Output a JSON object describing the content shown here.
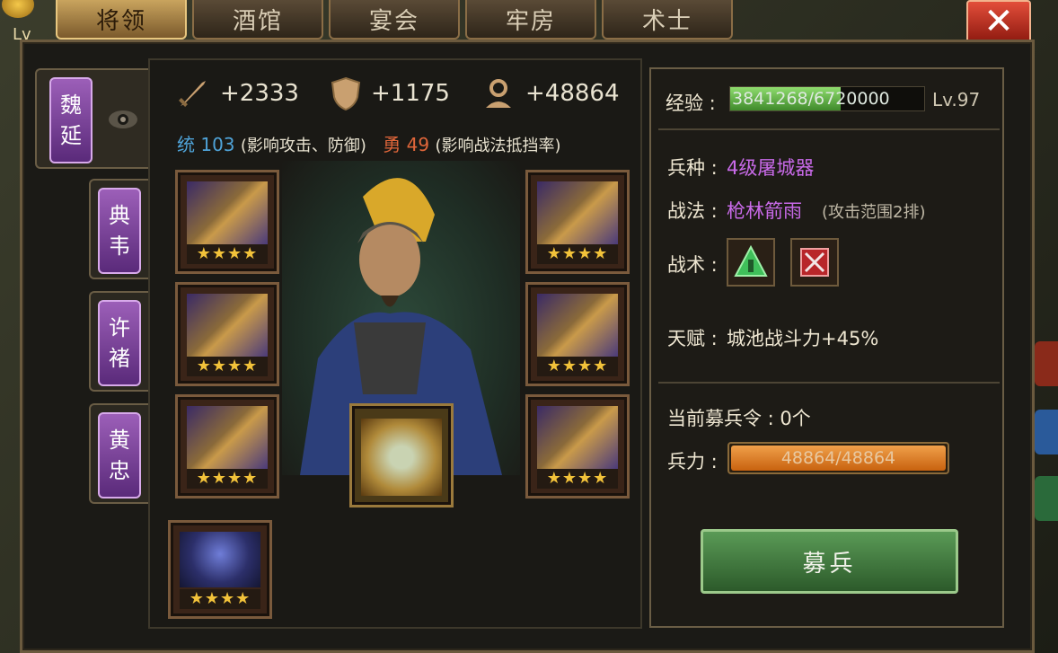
{
  "player": {
    "level_label": "Lv"
  },
  "tabs": [
    {
      "label": "将领",
      "active": true
    },
    {
      "label": "酒馆",
      "active": false
    },
    {
      "label": "宴会",
      "active": false
    },
    {
      "label": "牢房",
      "active": false
    },
    {
      "label": "术士",
      "active": false
    }
  ],
  "close_icon": "close-icon",
  "generals": [
    {
      "name_top": "魏",
      "name_bottom": "延",
      "selected": true
    },
    {
      "name_top": "典",
      "name_bottom": "韦",
      "selected": false
    },
    {
      "name_top": "许",
      "name_bottom": "褚",
      "selected": false
    },
    {
      "name_top": "黄",
      "name_bottom": "忠",
      "selected": false
    }
  ],
  "stats": {
    "attack": "+2333",
    "defense": "+1175",
    "troops": "+48864"
  },
  "attributes": {
    "command_label": "统",
    "command_value": "103",
    "command_note": "(影响攻击、防御)",
    "courage_label": "勇",
    "courage_value": "49",
    "courage_note": "(影响战法抵挡率)"
  },
  "equipment_slots": {
    "stars": "★★★★"
  },
  "info": {
    "exp_label": "经验 :",
    "exp_value": "3841268/6720000",
    "exp_progress": 0.571,
    "level": "Lv.97",
    "unit_label": "兵种 :",
    "unit_value": "4级屠城器",
    "skill_label": "战法 :",
    "skill_value": "枪林箭雨",
    "skill_note": "(攻击范围2排)",
    "tactic_label": "战术 :",
    "talent_label": "天赋 :",
    "talent_value": "城池战斗力+45%",
    "recruit_token_label": "当前募兵令 : 0个",
    "troop_label": "兵力 :",
    "troop_value": "48864/48864",
    "troop_progress": 1.0,
    "recruit_button": "募兵"
  },
  "colors": {
    "accent_gold": "#c9a45e",
    "purple_text": "#c86ae8",
    "command_blue": "#4fa3d8",
    "courage_red": "#e0663a",
    "recruit_green": "#5a9a56"
  }
}
